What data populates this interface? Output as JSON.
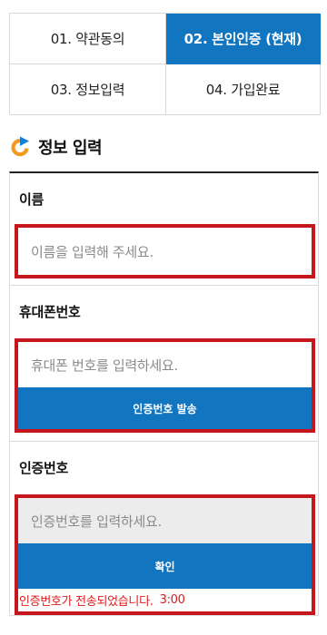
{
  "steps": [
    {
      "label": "01. 약관동의",
      "active": false
    },
    {
      "label": "02. 본인인증 (현재)",
      "active": true
    },
    {
      "label": "03. 정보입력",
      "active": false
    },
    {
      "label": "04. 가입완료",
      "active": false
    }
  ],
  "section": {
    "title": "정보 입력",
    "icon": "refresh-arrow-icon"
  },
  "form": {
    "name": {
      "label": "이름",
      "placeholder": "이름을 입력해 주세요."
    },
    "phone": {
      "label": "휴대폰번호",
      "placeholder": "휴대폰 번호를 입력하세요.",
      "button": "인증번호 발송"
    },
    "code": {
      "label": "인증번호",
      "placeholder": "인증번호를 입력하세요.",
      "button": "확인",
      "notice": "인증번호가 전송되었습니다.",
      "timer": "3:00"
    }
  },
  "colors": {
    "accent": "#1275c0",
    "highlight": "#c4161c",
    "notice": "#e01a1a",
    "icon_orange": "#f39a1e"
  }
}
